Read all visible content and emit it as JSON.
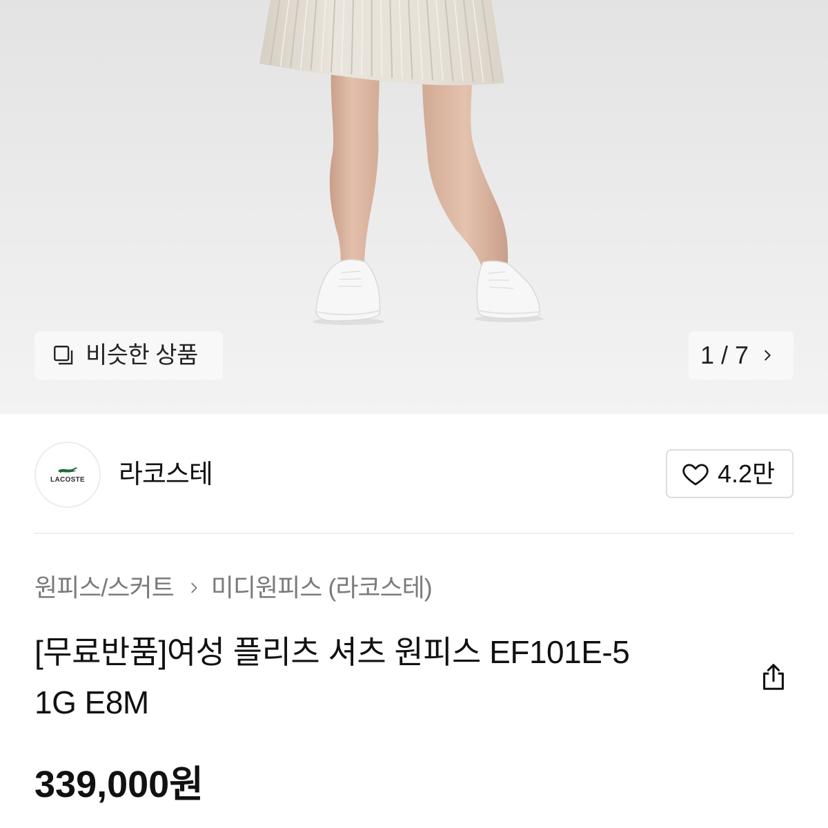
{
  "gallery": {
    "similar_button": {
      "icon": "similar-items-icon",
      "label": "비슷한 상품"
    },
    "pager": {
      "label": "1 / 7",
      "icon": "chevron-right-icon"
    }
  },
  "brand": {
    "logo": {
      "text": "LACOSTE",
      "icon": "crocodile-icon"
    },
    "name": "라코스테",
    "like_button": {
      "icon": "heart-outline-icon",
      "count": "4.2만"
    }
  },
  "breadcrumb": {
    "category": "원피스/스커트",
    "separator_icon": "chevron-right-icon",
    "subcategory": "미디원피스 (라코스테)"
  },
  "product": {
    "title_lines": [
      "[무료반품]여성 플리츠 셔츠 원피스 EF101E-5",
      "1G E8M"
    ],
    "share_icon": "share-icon",
    "price": "339,000원"
  },
  "colors": {
    "page_background": "#ffffff",
    "image_background": "#ececec",
    "text_primary": "#111111",
    "text_secondary": "#7a7a7a",
    "border": "#dcdcdc",
    "logo_green": "#1e6a3a"
  }
}
